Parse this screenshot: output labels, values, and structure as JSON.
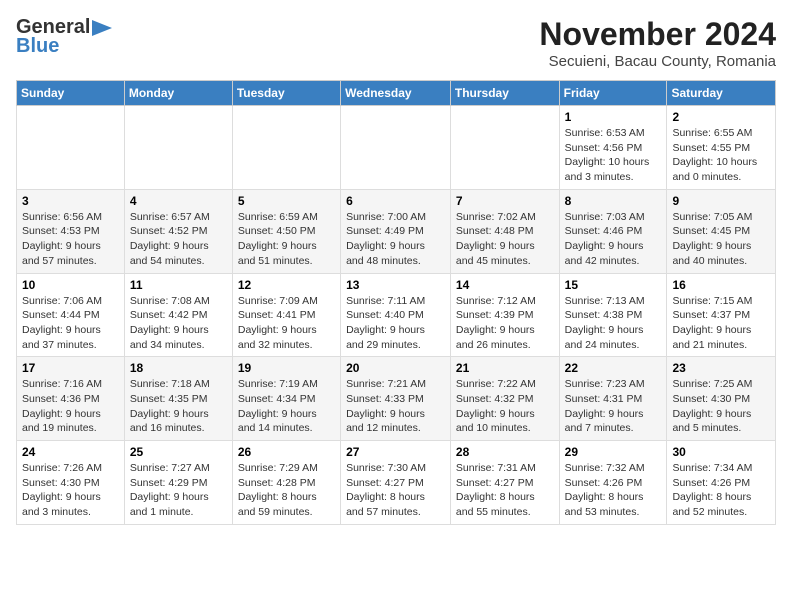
{
  "header": {
    "logo_general": "General",
    "logo_blue": "Blue",
    "month_title": "November 2024",
    "location": "Secuieni, Bacau County, Romania"
  },
  "weekdays": [
    "Sunday",
    "Monday",
    "Tuesday",
    "Wednesday",
    "Thursday",
    "Friday",
    "Saturday"
  ],
  "weeks": [
    [
      {
        "day": "",
        "info": ""
      },
      {
        "day": "",
        "info": ""
      },
      {
        "day": "",
        "info": ""
      },
      {
        "day": "",
        "info": ""
      },
      {
        "day": "",
        "info": ""
      },
      {
        "day": "1",
        "info": "Sunrise: 6:53 AM\nSunset: 4:56 PM\nDaylight: 10 hours and 3 minutes."
      },
      {
        "day": "2",
        "info": "Sunrise: 6:55 AM\nSunset: 4:55 PM\nDaylight: 10 hours and 0 minutes."
      }
    ],
    [
      {
        "day": "3",
        "info": "Sunrise: 6:56 AM\nSunset: 4:53 PM\nDaylight: 9 hours and 57 minutes."
      },
      {
        "day": "4",
        "info": "Sunrise: 6:57 AM\nSunset: 4:52 PM\nDaylight: 9 hours and 54 minutes."
      },
      {
        "day": "5",
        "info": "Sunrise: 6:59 AM\nSunset: 4:50 PM\nDaylight: 9 hours and 51 minutes."
      },
      {
        "day": "6",
        "info": "Sunrise: 7:00 AM\nSunset: 4:49 PM\nDaylight: 9 hours and 48 minutes."
      },
      {
        "day": "7",
        "info": "Sunrise: 7:02 AM\nSunset: 4:48 PM\nDaylight: 9 hours and 45 minutes."
      },
      {
        "day": "8",
        "info": "Sunrise: 7:03 AM\nSunset: 4:46 PM\nDaylight: 9 hours and 42 minutes."
      },
      {
        "day": "9",
        "info": "Sunrise: 7:05 AM\nSunset: 4:45 PM\nDaylight: 9 hours and 40 minutes."
      }
    ],
    [
      {
        "day": "10",
        "info": "Sunrise: 7:06 AM\nSunset: 4:44 PM\nDaylight: 9 hours and 37 minutes."
      },
      {
        "day": "11",
        "info": "Sunrise: 7:08 AM\nSunset: 4:42 PM\nDaylight: 9 hours and 34 minutes."
      },
      {
        "day": "12",
        "info": "Sunrise: 7:09 AM\nSunset: 4:41 PM\nDaylight: 9 hours and 32 minutes."
      },
      {
        "day": "13",
        "info": "Sunrise: 7:11 AM\nSunset: 4:40 PM\nDaylight: 9 hours and 29 minutes."
      },
      {
        "day": "14",
        "info": "Sunrise: 7:12 AM\nSunset: 4:39 PM\nDaylight: 9 hours and 26 minutes."
      },
      {
        "day": "15",
        "info": "Sunrise: 7:13 AM\nSunset: 4:38 PM\nDaylight: 9 hours and 24 minutes."
      },
      {
        "day": "16",
        "info": "Sunrise: 7:15 AM\nSunset: 4:37 PM\nDaylight: 9 hours and 21 minutes."
      }
    ],
    [
      {
        "day": "17",
        "info": "Sunrise: 7:16 AM\nSunset: 4:36 PM\nDaylight: 9 hours and 19 minutes."
      },
      {
        "day": "18",
        "info": "Sunrise: 7:18 AM\nSunset: 4:35 PM\nDaylight: 9 hours and 16 minutes."
      },
      {
        "day": "19",
        "info": "Sunrise: 7:19 AM\nSunset: 4:34 PM\nDaylight: 9 hours and 14 minutes."
      },
      {
        "day": "20",
        "info": "Sunrise: 7:21 AM\nSunset: 4:33 PM\nDaylight: 9 hours and 12 minutes."
      },
      {
        "day": "21",
        "info": "Sunrise: 7:22 AM\nSunset: 4:32 PM\nDaylight: 9 hours and 10 minutes."
      },
      {
        "day": "22",
        "info": "Sunrise: 7:23 AM\nSunset: 4:31 PM\nDaylight: 9 hours and 7 minutes."
      },
      {
        "day": "23",
        "info": "Sunrise: 7:25 AM\nSunset: 4:30 PM\nDaylight: 9 hours and 5 minutes."
      }
    ],
    [
      {
        "day": "24",
        "info": "Sunrise: 7:26 AM\nSunset: 4:30 PM\nDaylight: 9 hours and 3 minutes."
      },
      {
        "day": "25",
        "info": "Sunrise: 7:27 AM\nSunset: 4:29 PM\nDaylight: 9 hours and 1 minute."
      },
      {
        "day": "26",
        "info": "Sunrise: 7:29 AM\nSunset: 4:28 PM\nDaylight: 8 hours and 59 minutes."
      },
      {
        "day": "27",
        "info": "Sunrise: 7:30 AM\nSunset: 4:27 PM\nDaylight: 8 hours and 57 minutes."
      },
      {
        "day": "28",
        "info": "Sunrise: 7:31 AM\nSunset: 4:27 PM\nDaylight: 8 hours and 55 minutes."
      },
      {
        "day": "29",
        "info": "Sunrise: 7:32 AM\nSunset: 4:26 PM\nDaylight: 8 hours and 53 minutes."
      },
      {
        "day": "30",
        "info": "Sunrise: 7:34 AM\nSunset: 4:26 PM\nDaylight: 8 hours and 52 minutes."
      }
    ]
  ]
}
